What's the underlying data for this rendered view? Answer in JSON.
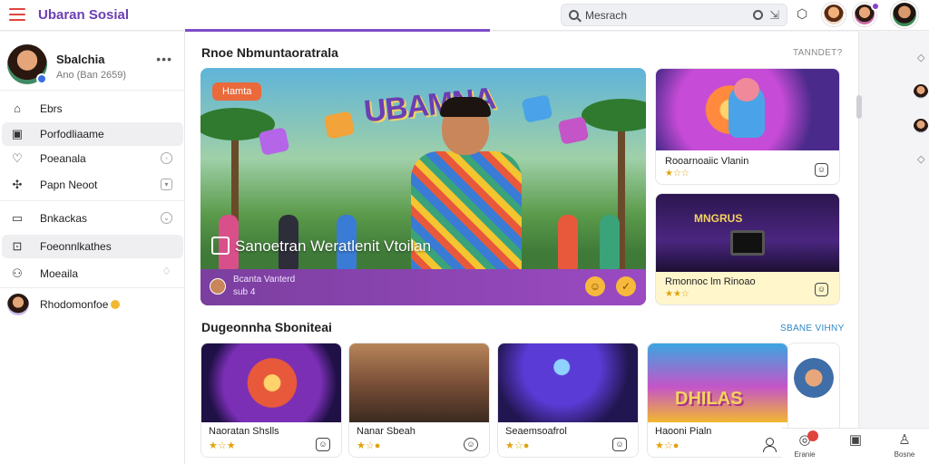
{
  "app": {
    "brand": "Ubaran Sosial"
  },
  "search": {
    "placeholder": "Mesrach"
  },
  "profile": {
    "name": "Sbalchia",
    "subtitle": "Ano (Ban 2659)"
  },
  "sidebar": {
    "items": [
      {
        "icon": "home-icon",
        "label": "Ebrs"
      },
      {
        "icon": "photo-icon",
        "label": "Porfodliaame",
        "active": true
      },
      {
        "icon": "heart-icon",
        "label": "Poeanala"
      },
      {
        "icon": "puzzle-icon",
        "label": "Papn Neoot"
      },
      {
        "icon": "bookmark-icon",
        "label": "Bnkackas"
      },
      {
        "icon": "calendar-icon",
        "label": "Foeonnlkathes",
        "active": true
      },
      {
        "icon": "group-icon",
        "label": "Moeaila"
      },
      {
        "icon": "avatar",
        "label": "Rhodomonfoe"
      }
    ]
  },
  "main": {
    "section1_title": "Rnoe Nbmuntaoratrala",
    "section1_link": "TANNDET?",
    "hero": {
      "tag": "Hamta",
      "art_title": "UBAMNA",
      "caption": "Sanoetran Weratlenit Vtoilan",
      "user_line1": "Bcanta Vanterd",
      "user_line2": "sub 4"
    },
    "side_cards": [
      {
        "label": "Rooarnoaiic Vlanin",
        "stars": "★☆☆"
      },
      {
        "label": "Rmonnoc lm Rinoao",
        "stars": "★★☆",
        "art": "MNGRUS"
      }
    ],
    "section2_title": "Dugeonnha Sboniteai",
    "section2_link": "SBANE VIHNY",
    "thumbs": [
      {
        "label": "Naoratan Shslls",
        "stars": "★☆★"
      },
      {
        "label": "Nanar Sbeah",
        "stars": "★☆●"
      },
      {
        "label": "Seaemsoafrol",
        "stars": "★☆●"
      },
      {
        "label": "Haooni Pialn",
        "stars": "★☆●",
        "art": "DHILAS"
      }
    ]
  },
  "tabbar": {
    "items": [
      {
        "icon": "globe-icon",
        "label": "Eranie"
      },
      {
        "icon": "bookmark-icon",
        "label": ""
      },
      {
        "icon": "person-icon",
        "label": "Bosne"
      }
    ]
  },
  "colors": {
    "accent": "#7b4cc9",
    "brand": "#6b3fb3",
    "menu": "#e0443c"
  }
}
